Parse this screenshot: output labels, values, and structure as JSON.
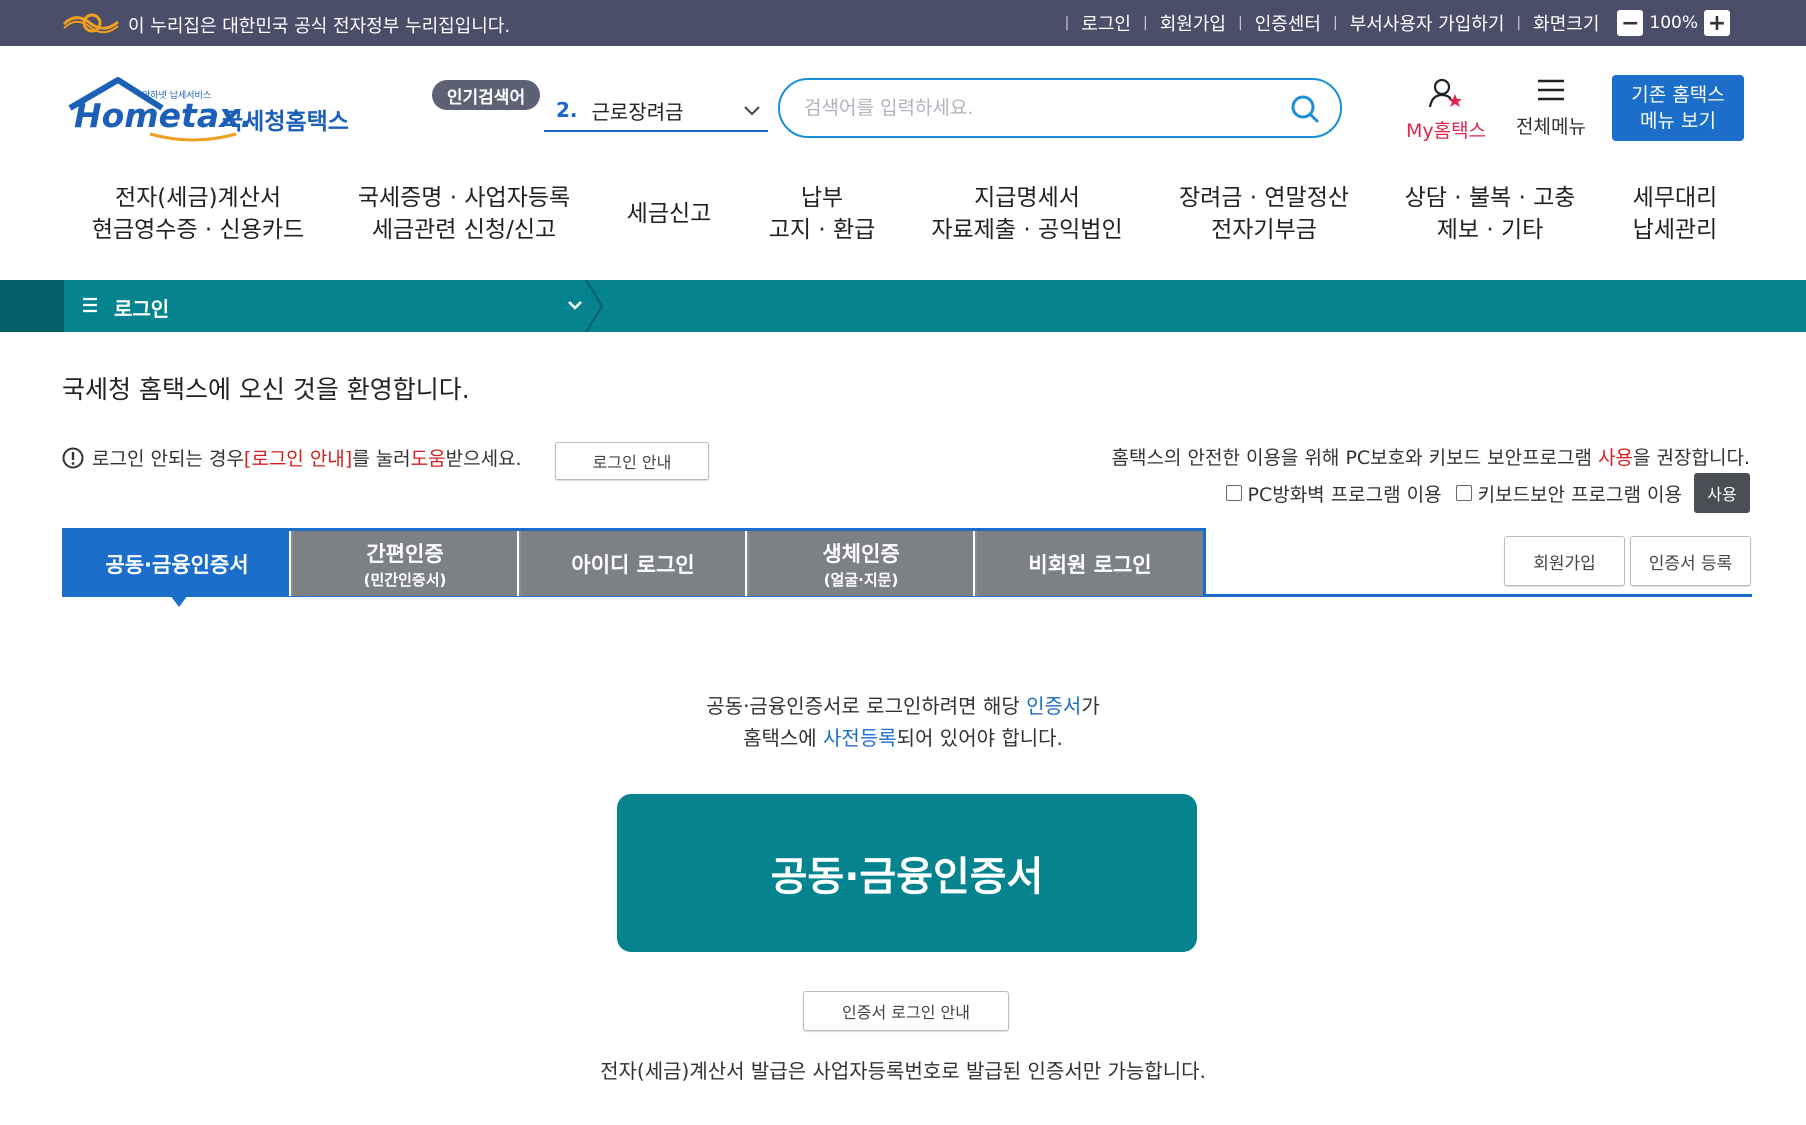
{
  "gov_bar": {
    "notice": "이 누리집은 대한민국 공식 전자정부 누리집입니다.",
    "links": [
      "로그인",
      "회원가입",
      "인증센터",
      "부서사용자 가입하기"
    ],
    "zoom_label": "화면크기",
    "zoom_minus": "−",
    "zoom_value": "100%",
    "zoom_plus": "+"
  },
  "header": {
    "logo_small": "안하넷 납세서비스",
    "logo_main": "Hometax.",
    "logo_kr": "국세청홈택스",
    "popular_label": "인기검색어",
    "popular_num": "2.",
    "popular_term": "근로장려금",
    "search_placeholder": "검색어를 입력하세요.",
    "my_hometax": "My홈택스",
    "all_menu": "전체메뉴",
    "old_menu_line1": "기존 홈택스",
    "old_menu_line2": "메뉴 보기"
  },
  "gnb": [
    {
      "l1": "전자(세금)계산서",
      "l2": "현금영수증 · 신용카드"
    },
    {
      "l1": "국세증명 · 사업자등록",
      "l2": "세금관련 신청/신고"
    },
    {
      "l1": "세금신고",
      "l2": ""
    },
    {
      "l1": "납부",
      "l2": "고지 · 환급"
    },
    {
      "l1": "지급명세서",
      "l2": "자료제출 · 공익법인"
    },
    {
      "l1": "장려금 · 연말정산",
      "l2": "전자기부금"
    },
    {
      "l1": "상담 · 불복 · 고충",
      "l2": "제보 · 기타"
    },
    {
      "l1": "세무대리",
      "l2": "납세관리"
    }
  ],
  "location": {
    "title": "로그인"
  },
  "content": {
    "welcome": "국세청 홈택스에 오신 것을 환영합니다.",
    "help_1": "로그인 안되는 경우 ",
    "help_red1": "[로그인 안내]",
    "help_2": "를 눌러 ",
    "help_red2": "도움",
    "help_3": "받으세요.",
    "login_guide_btn": "로그인 안내",
    "security_1": "홈택스의 안전한 이용을 위해 PC보호와 키보드 보안프로그램 ",
    "security_red": "사용",
    "security_2": "을 권장합니다.",
    "opt_firewall": "PC방화벽 프로그램 이용",
    "opt_keyboard": "키보드보안 프로그램 이용",
    "use_btn": "사용"
  },
  "tabs": [
    {
      "label": "공동·금융인증서",
      "sub": ""
    },
    {
      "label": "간편인증",
      "sub": "(민간인증서)"
    },
    {
      "label": "아이디 로그인",
      "sub": ""
    },
    {
      "label": "생체인증",
      "sub": "(얼굴·지문)"
    },
    {
      "label": "비회원 로그인",
      "sub": ""
    }
  ],
  "side_buttons": {
    "signup": "회원가입",
    "cert_register": "인증서 등록"
  },
  "cert": {
    "desc1_a": "공동·금융인증서로 로그인하려면 해당 ",
    "desc1_blue": "인증서",
    "desc1_b": "가",
    "desc2_a": "홈택스에 ",
    "desc2_blue": "사전등록",
    "desc2_b": "되어 있어야 합니다.",
    "big_button": "공동·금융인증서",
    "guide_button": "인증서 로그인 안내",
    "notice": "전자(세금)계산서 발급은 사업자등록번호로 발급된 인증서만 가능합니다."
  },
  "colors": {
    "gov_bar": "#4a4e69",
    "teal": "#05838f",
    "blue": "#1b6ec9",
    "red": "#d62020"
  }
}
